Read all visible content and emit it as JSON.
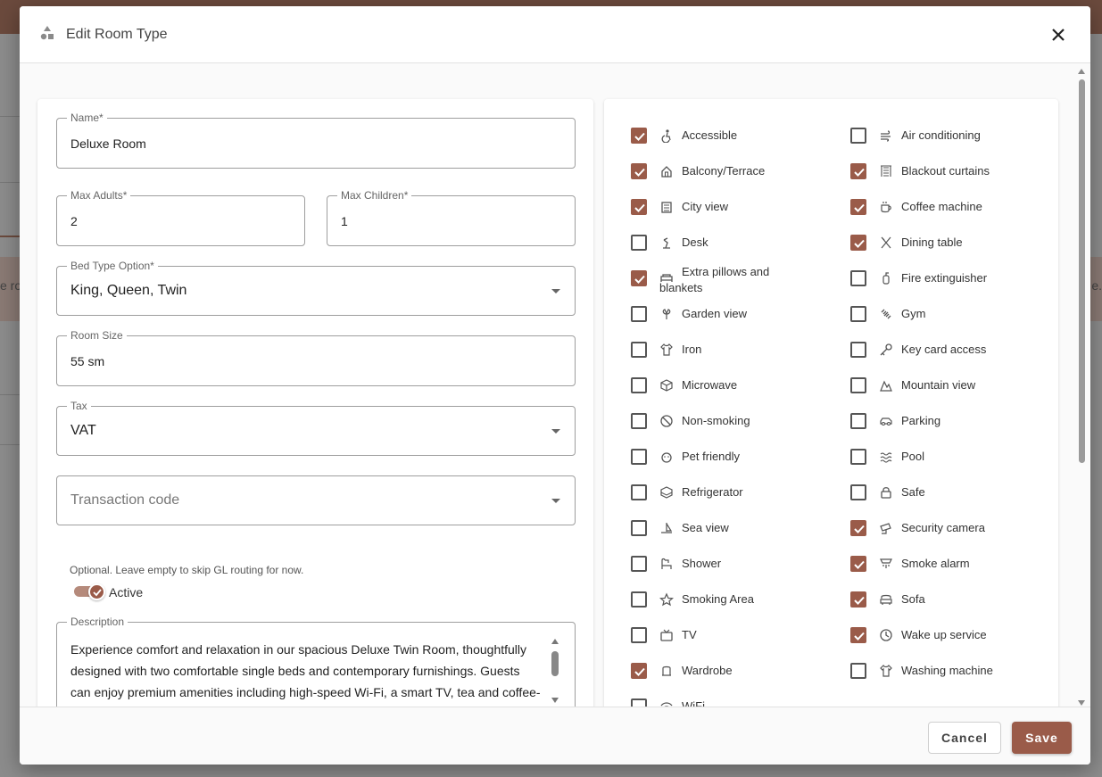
{
  "dialog": {
    "title": "Edit Room Type",
    "close_icon": "close-icon",
    "title_icon": "shapes-icon"
  },
  "form": {
    "name": {
      "label": "Name*",
      "value": "Deluxe Room"
    },
    "max_adults": {
      "label": "Max Adults*",
      "value": "2"
    },
    "max_children": {
      "label": "Max Children*",
      "value": "1"
    },
    "bed_type": {
      "label": "Bed Type Option*",
      "value": "King, Queen, Twin"
    },
    "room_size": {
      "label": "Room Size",
      "value": "55 sm"
    },
    "tax": {
      "label": "Tax",
      "value": "VAT"
    },
    "transaction_code": {
      "placeholder": "Transaction code",
      "hint": "Optional. Leave empty to skip GL routing for now."
    },
    "active": {
      "label": "Active",
      "checked": true
    },
    "description": {
      "label": "Description",
      "value": "Experience comfort and relaxation in our spacious Deluxe Twin Room, thoughtfully designed with two comfortable single beds and contemporary furnishings. Guests can enjoy premium amenities including high-speed Wi-Fi, a smart TV, tea and coffee-making facilities, a minibar, and a private bathroom"
    }
  },
  "amenities": {
    "left": [
      {
        "label": "Accessible",
        "checked": true,
        "icon": "accessible-icon"
      },
      {
        "label": "Balcony/Terrace",
        "checked": true,
        "icon": "balcony-icon"
      },
      {
        "label": "City view",
        "checked": true,
        "icon": "city-icon"
      },
      {
        "label": "Desk",
        "checked": false,
        "icon": "desk-lamp-icon"
      },
      {
        "label": "Extra pillows and blankets",
        "checked": true,
        "icon": "bed-icon"
      },
      {
        "label": "Garden view",
        "checked": false,
        "icon": "garden-icon"
      },
      {
        "label": "Iron",
        "checked": false,
        "icon": "shirt-icon"
      },
      {
        "label": "Microwave",
        "checked": false,
        "icon": "box-icon"
      },
      {
        "label": "Non-smoking",
        "checked": false,
        "icon": "no-smoking-icon"
      },
      {
        "label": "Pet friendly",
        "checked": false,
        "icon": "pet-icon"
      },
      {
        "label": "Refrigerator",
        "checked": false,
        "icon": "fridge-icon"
      },
      {
        "label": "Sea view",
        "checked": false,
        "icon": "sailboat-icon"
      },
      {
        "label": "Shower",
        "checked": false,
        "icon": "shower-icon"
      },
      {
        "label": "Smoking Area",
        "checked": false,
        "icon": "star-icon"
      },
      {
        "label": "TV",
        "checked": false,
        "icon": "tv-icon"
      },
      {
        "label": "Wardrobe",
        "checked": true,
        "icon": "wardrobe-icon"
      },
      {
        "label": "WiFi",
        "checked": false,
        "icon": "wifi-icon"
      }
    ],
    "right": [
      {
        "label": "Air conditioning",
        "checked": false,
        "icon": "wind-icon"
      },
      {
        "label": "Blackout curtains",
        "checked": true,
        "icon": "curtains-icon"
      },
      {
        "label": "Coffee machine",
        "checked": true,
        "icon": "coffee-icon"
      },
      {
        "label": "Dining table",
        "checked": true,
        "icon": "utensils-icon"
      },
      {
        "label": "Fire extinguisher",
        "checked": false,
        "icon": "fire-extinguisher-icon"
      },
      {
        "label": "Gym",
        "checked": false,
        "icon": "dumbbell-icon"
      },
      {
        "label": "Key card access",
        "checked": false,
        "icon": "key-icon"
      },
      {
        "label": "Mountain view",
        "checked": false,
        "icon": "mountain-icon"
      },
      {
        "label": "Parking",
        "checked": false,
        "icon": "car-icon"
      },
      {
        "label": "Pool",
        "checked": false,
        "icon": "waves-icon"
      },
      {
        "label": "Safe",
        "checked": false,
        "icon": "lock-icon"
      },
      {
        "label": "Security camera",
        "checked": true,
        "icon": "camera-icon"
      },
      {
        "label": "Smoke alarm",
        "checked": true,
        "icon": "alarm-icon"
      },
      {
        "label": "Sofa",
        "checked": true,
        "icon": "sofa-icon"
      },
      {
        "label": "Wake up service",
        "checked": true,
        "icon": "clock-icon"
      },
      {
        "label": "Washing machine",
        "checked": false,
        "icon": "shirt-icon"
      }
    ]
  },
  "footer": {
    "cancel_label": "Cancel",
    "save_label": "Save"
  },
  "background": {
    "left_fragment": "e ro",
    "right_fragment": "e."
  },
  "colors": {
    "accent": "#9a5b49",
    "header_bar": "#6b4a3d"
  }
}
